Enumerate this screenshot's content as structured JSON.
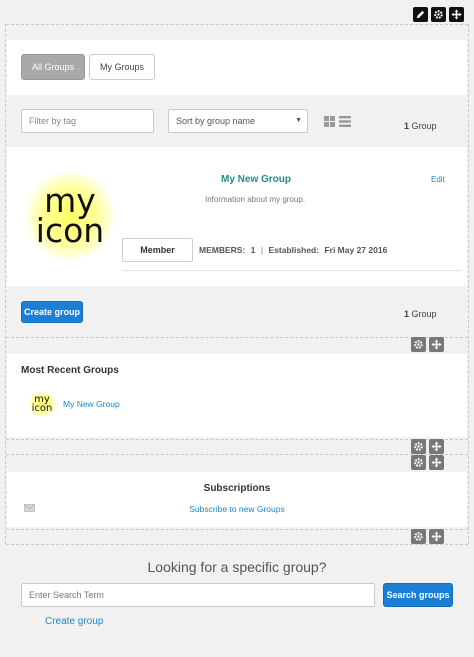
{
  "toolbar_icons": [
    "pencil-icon",
    "gear-icon",
    "move-icon"
  ],
  "tabs": {
    "all": "All Groups",
    "mine": "My Groups"
  },
  "filter": {
    "placeholder": "Filter by tag",
    "sort_label": "Sort by group name",
    "count_num": "1",
    "count_word": "Group"
  },
  "group": {
    "logo_line1": "my",
    "logo_line2": "icon",
    "name": "My New Group",
    "edit": "Edit",
    "description": "Information about my group.",
    "member_button": "Member",
    "members_label": "MEMBERS:",
    "members_count": "1",
    "established_label": "Established:",
    "established_date": "Fri May 27 2016"
  },
  "footer_bar": {
    "create_button": "Create group",
    "count_num": "1",
    "count_word": "Group"
  },
  "recent": {
    "title": "Most Recent Groups",
    "item_logo_line1": "my",
    "item_logo_line2": "icon",
    "item_name": "My New Group"
  },
  "subscriptions": {
    "title": "Subscriptions",
    "link": "Subscribe to new Groups"
  },
  "search": {
    "heading": "Looking for a specific group?",
    "placeholder": "Enter Search Term",
    "button": "Search groups",
    "create_link": "Create group"
  },
  "colors": {
    "accent": "#1a7fd6",
    "teal": "#238b8b",
    "link": "#1e88c9"
  }
}
